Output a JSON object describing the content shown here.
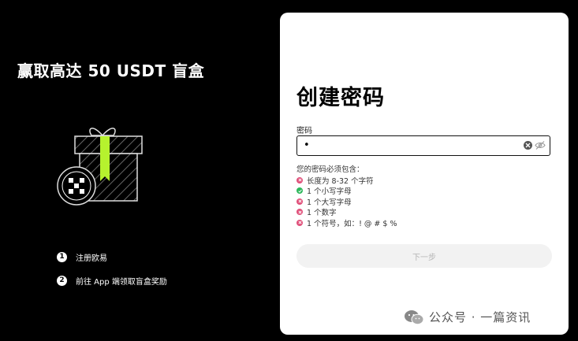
{
  "promo": {
    "title": "赢取高达 50 USDT 盲盒",
    "steps": [
      {
        "num": "1",
        "label": "注册欧易"
      },
      {
        "num": "2",
        "label": "前往 App 端领取盲盒奖励"
      }
    ]
  },
  "form": {
    "title": "创建密码",
    "password_label": "密码",
    "password_value": "•",
    "requirements_title": "您的密码必须包含：",
    "requirements": [
      {
        "text": "长度为 8-32 个字符",
        "met": false
      },
      {
        "text": "1 个小写字母",
        "met": true
      },
      {
        "text": "1 个大写字母",
        "met": false
      },
      {
        "text": "1 个数字",
        "met": false
      },
      {
        "text": "1 个符号，如：! @ # $ %",
        "met": false
      }
    ],
    "next_button": "下一步"
  },
  "watermark": {
    "text": "公众号 · 一篇资讯"
  },
  "colors": {
    "fail": "#e0507a",
    "pass": "#2eb85c",
    "accent_ribbon": "#b6f22e"
  },
  "icons": {
    "clear": "clear-circle-icon",
    "visibility": "eye-off-icon",
    "gift": "gift-box-icon",
    "okx_logo": "okx-logo-icon"
  }
}
